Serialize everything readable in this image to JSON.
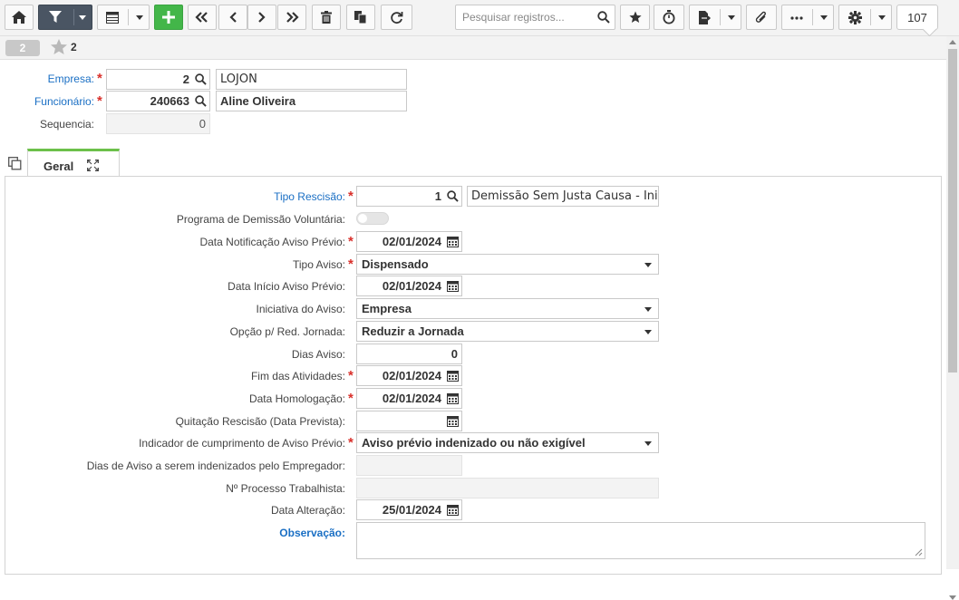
{
  "toolbar": {
    "search_placeholder": "Pesquisar registros...",
    "record_counter": "107",
    "icons": [
      "home-icon",
      "filter-icon",
      "grid-icon",
      "plus-icon",
      "first-record-icon",
      "prev-record-icon",
      "next-record-icon",
      "last-record-icon",
      "delete-icon",
      "copy-icon",
      "refresh-icon",
      "search-icon",
      "star-icon",
      "stopwatch-icon",
      "file-export-icon",
      "paperclip-icon",
      "more-icon",
      "gear-icon"
    ],
    "colors": {
      "dark_button": "#4a5563",
      "add_button": "#43b649"
    }
  },
  "record_strip": {
    "badge": "2",
    "favorites_count": "2"
  },
  "header": {
    "empresa": {
      "label": "Empresa:",
      "code": "2",
      "name": "LOJON",
      "required": "*"
    },
    "funcionario": {
      "label": "Funcionário:",
      "code": "240663",
      "name": "Aline Oliveira",
      "required": "*"
    },
    "sequencia": {
      "label": "Sequencia:",
      "value": "0"
    }
  },
  "tabs": [
    {
      "label": "Geral",
      "active": true
    }
  ],
  "form": {
    "tipo_rescisao": {
      "label": "Tipo Rescisão:",
      "code": "1",
      "description": "Demissão Sem Justa Causa - Inic",
      "required": "*"
    },
    "programa_demissao": {
      "label": "Programa de Demissão Voluntária:",
      "value": "off"
    },
    "data_notificacao": {
      "label": "Data Notificação Aviso Prévio:",
      "value": "02/01/2024",
      "required": "*"
    },
    "tipo_aviso": {
      "label": "Tipo Aviso:",
      "value": "Dispensado",
      "required": "*"
    },
    "data_inicio_aviso": {
      "label": "Data Início Aviso Prévio:",
      "value": "02/01/2024"
    },
    "iniciativa_aviso": {
      "label": "Iniciativa do Aviso:",
      "value": "Empresa"
    },
    "opcao_red_jornada": {
      "label": "Opção p/ Red. Jornada:",
      "value": "Reduzir a Jornada"
    },
    "dias_aviso": {
      "label": "Dias Aviso:",
      "value": "0"
    },
    "fim_atividades": {
      "label": "Fim das Atividades:",
      "value": "02/01/2024",
      "required": "*"
    },
    "data_homologacao": {
      "label": "Data Homologação:",
      "value": "02/01/2024",
      "required": "*"
    },
    "quitacao_rescisao": {
      "label": "Quitação Rescisão (Data Prevista):",
      "value": ""
    },
    "indicador_cumprimento": {
      "label": "Indicador de cumprimento de Aviso Prévio:",
      "value": "Aviso prévio indenizado ou não exigível",
      "required": "*"
    },
    "dias_indenizados": {
      "label": "Dias de Aviso a serem indenizados pelo Empregador:",
      "value": ""
    },
    "processo_trabalhista": {
      "label": "Nº Processo Trabalhista:",
      "value": ""
    },
    "data_alteracao": {
      "label": "Data Alteração:",
      "value": "25/01/2024"
    },
    "observacao": {
      "label": "Observação:",
      "value": ""
    }
  }
}
